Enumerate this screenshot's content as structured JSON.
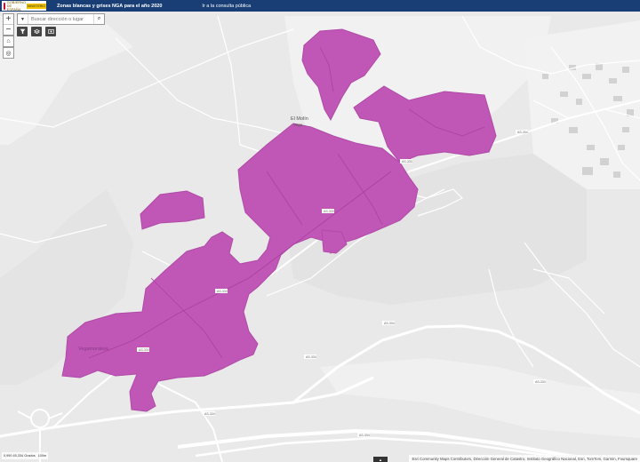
{
  "header": {
    "logo_text": "GOBIERNO DE ESPAÑA",
    "ministry_text": "MINISTERIO",
    "title": "Zonas blancas y grises NGA para el año 2020",
    "link": "Ir a la consulta pública"
  },
  "search": {
    "placeholder": "Buscar dirección o lugar"
  },
  "controls": {
    "zoom_in": "+",
    "zoom_out": "−",
    "home": "⌂",
    "locate": "◎",
    "search_dropdown": "▼",
    "search_button": "⌕",
    "filter_icon": "funnel-icon",
    "layers_icon": "layers-icon",
    "legend_icon": "legend-icon"
  },
  "map": {
    "place_labels": {
      "el_molin": "El Molín",
      "vegamoraleja": "Vegamoraleja",
      "el_molin_sub": "Vega..."
    },
    "road_labels": [
      "AS-334",
      "AS-330",
      "AS-330",
      "AS-330",
      "AS-330",
      "AS-334",
      "AS-334",
      "AS-334",
      "AS-334",
      "AS-334"
    ],
    "colors": {
      "zone": "#c057b7",
      "zone_stroke": "#b04aa7",
      "background": "#e9e9e9",
      "road": "#ffffff"
    }
  },
  "scale": {
    "text": "0,990 45,334 Grados",
    "bar": "100m"
  },
  "attribution": "Esri Community Maps Contributors, Dirección General de Catastro, Instituto Geográfico Nacional, Esri, TomTom, Garmin, Foursquare",
  "footer": {
    "toggle": "▲"
  }
}
